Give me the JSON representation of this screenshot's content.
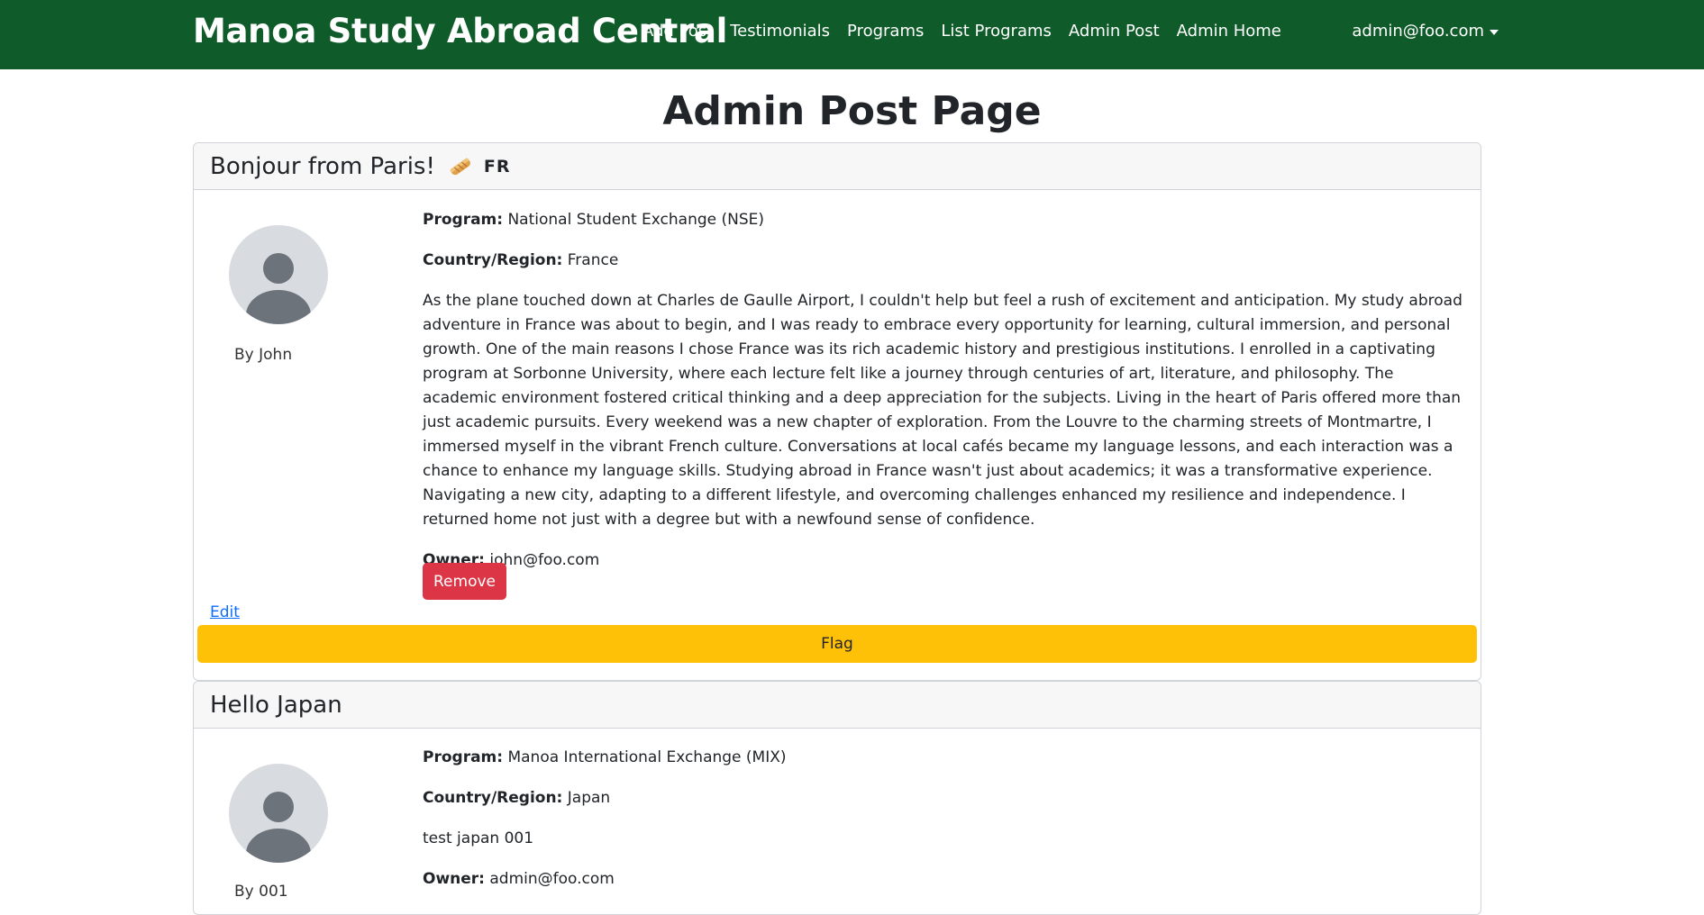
{
  "navbar": {
    "brand": "Manoa Study Abroad Central",
    "links": [
      "Add Post",
      "Testimonials",
      "Programs",
      "List Programs",
      "Admin Post",
      "Admin Home"
    ],
    "user": "admin@foo.com",
    "bg_color": "#0f5c2a"
  },
  "page": {
    "title": "Admin Post Page"
  },
  "posts": [
    {
      "title": "Bonjour from Paris!",
      "icon": "bread-icon",
      "country_code": "FR",
      "author": "By John",
      "program_label": "Program:",
      "program": "National Student Exchange (NSE)",
      "country_label": "Country/Region:",
      "country": "France",
      "body": "As the plane touched down at Charles de Gaulle Airport, I couldn't help but feel a rush of excitement and anticipation. My study abroad adventure in France was about to begin, and I was ready to embrace every opportunity for learning, cultural immersion, and personal growth. One of the main reasons I chose France was its rich academic history and prestigious institutions. I enrolled in a captivating program at Sorbonne University, where each lecture felt like a journey through centuries of art, literature, and philosophy. The academic environment fostered critical thinking and a deep appreciation for the subjects. Living in the heart of Paris offered more than just academic pursuits. Every weekend was a new chapter of exploration. From the Louvre to the charming streets of Montmartre, I immersed myself in the vibrant French culture. Conversations at local cafés became my language lessons, and each interaction was a chance to enhance my language skills. Studying abroad in France wasn't just about academics; it was a transformative experience. Navigating a new city, adapting to a different lifestyle, and overcoming challenges enhanced my resilience and independence. I returned home not just with a degree but with a newfound sense of confidence.",
      "owner_label": "Owner:",
      "owner": "john@foo.com",
      "remove_label": "Remove",
      "edit_label": "Edit",
      "flag_label": "Flag"
    },
    {
      "title": "Hello Japan",
      "author": "By 001",
      "program_label": "Program:",
      "program": "Manoa International Exchange (MIX)",
      "country_label": "Country/Region:",
      "country": "Japan",
      "body": "test japan 001",
      "owner_label": "Owner:",
      "owner": "admin@foo.com"
    }
  ],
  "colors": {
    "remove": "#dc3545",
    "flag": "#ffc107",
    "link": "#0d6efd"
  }
}
